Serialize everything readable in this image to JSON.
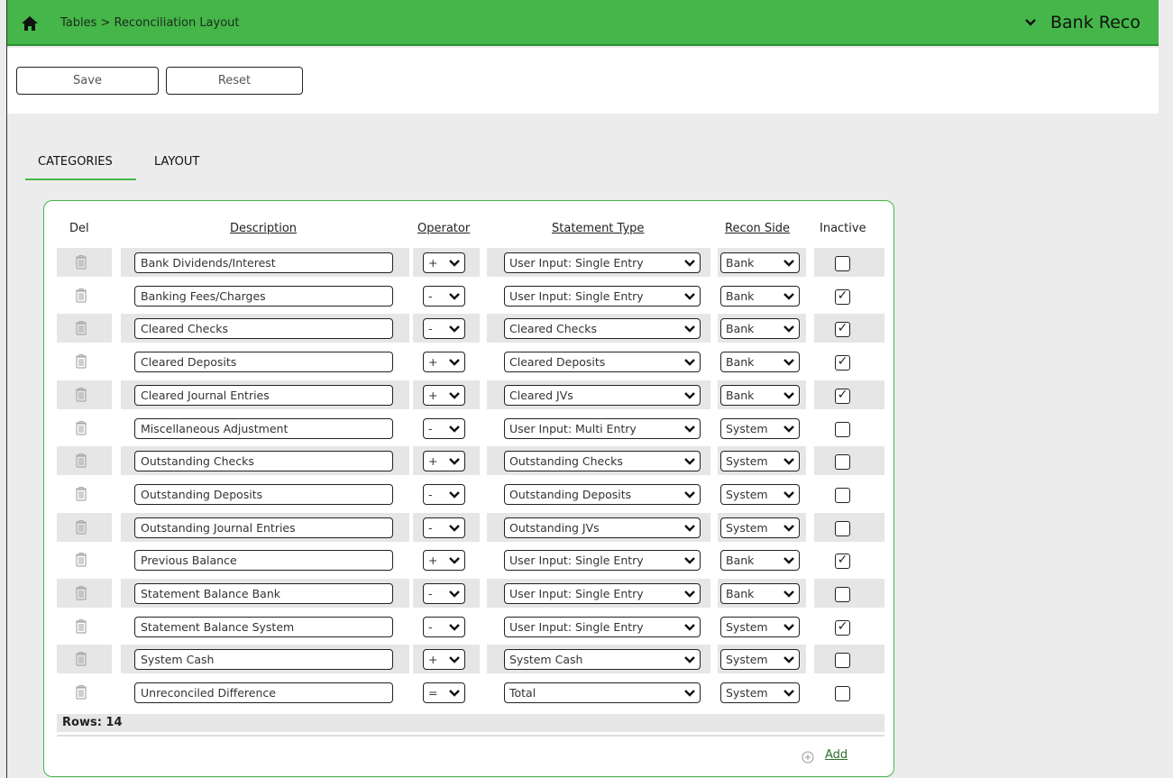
{
  "header": {
    "breadcrumb": "Tables > Reconciliation Layout",
    "module": "Bank Reco",
    "color": "#45b649"
  },
  "toolbar": {
    "save_label": "Save",
    "reset_label": "Reset"
  },
  "tabs": [
    {
      "label": "CATEGORIES",
      "active": true
    },
    {
      "label": "LAYOUT",
      "active": false
    }
  ],
  "table": {
    "columns": {
      "del": "Del",
      "description": "Description",
      "operator": "Operator",
      "statement_type": "Statement Type",
      "recon_side": "Recon Side",
      "inactive": "Inactive"
    },
    "rows": [
      {
        "description": "Bank Dividends/Interest",
        "operator": "+",
        "statement_type": "User Input: Single Entry",
        "recon_side": "Bank",
        "inactive": false
      },
      {
        "description": "Banking Fees/Charges",
        "operator": "-",
        "statement_type": "User Input: Single Entry",
        "recon_side": "Bank",
        "inactive": true
      },
      {
        "description": "Cleared Checks",
        "operator": "-",
        "statement_type": "Cleared Checks",
        "recon_side": "Bank",
        "inactive": true
      },
      {
        "description": "Cleared Deposits",
        "operator": "+",
        "statement_type": "Cleared Deposits",
        "recon_side": "Bank",
        "inactive": true
      },
      {
        "description": "Cleared Journal Entries",
        "operator": "+",
        "statement_type": "Cleared JVs",
        "recon_side": "Bank",
        "inactive": true
      },
      {
        "description": "Miscellaneous Adjustment",
        "operator": "-",
        "statement_type": "User Input: Multi Entry",
        "recon_side": "System",
        "inactive": false
      },
      {
        "description": "Outstanding Checks",
        "operator": "+",
        "statement_type": "Outstanding Checks",
        "recon_side": "System",
        "inactive": false
      },
      {
        "description": "Outstanding Deposits",
        "operator": "-",
        "statement_type": "Outstanding Deposits",
        "recon_side": "System",
        "inactive": false
      },
      {
        "description": "Outstanding Journal Entries",
        "operator": "-",
        "statement_type": "Outstanding JVs",
        "recon_side": "System",
        "inactive": false
      },
      {
        "description": "Previous Balance",
        "operator": "+",
        "statement_type": "User Input: Single Entry",
        "recon_side": "Bank",
        "inactive": true
      },
      {
        "description": "Statement Balance Bank",
        "operator": "-",
        "statement_type": "User Input: Single Entry",
        "recon_side": "Bank",
        "inactive": false
      },
      {
        "description": "Statement Balance System",
        "operator": "-",
        "statement_type": "User Input: Single Entry",
        "recon_side": "System",
        "inactive": true
      },
      {
        "description": "System Cash",
        "operator": "+",
        "statement_type": "System Cash",
        "recon_side": "System",
        "inactive": false
      },
      {
        "description": "Unreconciled Difference",
        "operator": "=",
        "statement_type": "Total",
        "recon_side": "System",
        "inactive": false
      }
    ],
    "rows_label": "Rows: 14",
    "add_label": "Add"
  }
}
